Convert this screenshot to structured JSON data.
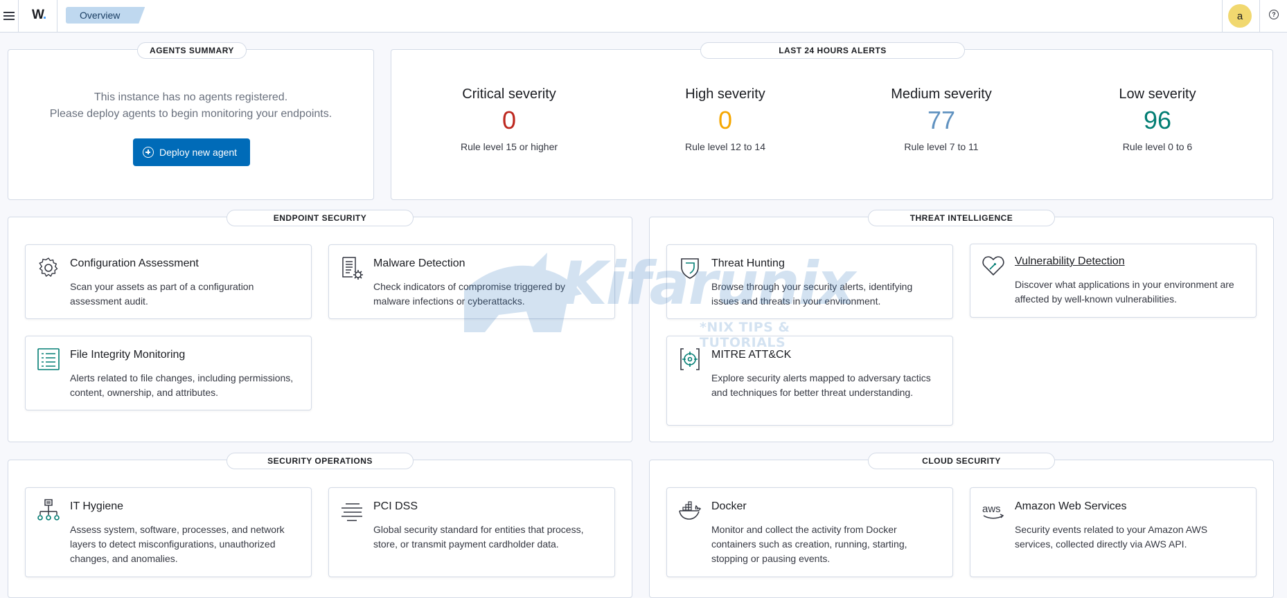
{
  "topbar": {
    "logo": "W",
    "logo_dot": ".",
    "breadcrumb": "Overview",
    "avatar_initial": "a",
    "help_glyph": "?"
  },
  "agents_summary": {
    "title": "AGENTS SUMMARY",
    "line1": "This instance has no agents registered.",
    "line2": "Please deploy agents to begin monitoring your endpoints.",
    "deploy_button": "Deploy new agent"
  },
  "alerts": {
    "title": "LAST 24 HOURS ALERTS",
    "items": [
      {
        "label": "Critical severity",
        "value": "0",
        "rule": "Rule level 15 or higher",
        "color": "#bd271e"
      },
      {
        "label": "High severity",
        "value": "0",
        "rule": "Rule level 12 to 14",
        "color": "#f5a700"
      },
      {
        "label": "Medium severity",
        "value": "77",
        "rule": "Rule level 7 to 11",
        "color": "#6092c0"
      },
      {
        "label": "Low severity",
        "value": "96",
        "rule": "Rule level 0 to 6",
        "color": "#017d73"
      }
    ]
  },
  "endpoint_security": {
    "title": "ENDPOINT SECURITY",
    "cards": [
      {
        "icon": "gear-icon",
        "title": "Configuration Assessment",
        "desc": "Scan your assets as part of a configuration assessment audit."
      },
      {
        "icon": "malware-report-icon",
        "title": "Malware Detection",
        "desc": "Check indicators of compromise triggered by malware infections or cyberattacks."
      },
      {
        "icon": "file-list-icon",
        "title": "File Integrity Monitoring",
        "desc": "Alerts related to file changes, including permissions, content, ownership, and attributes."
      }
    ]
  },
  "threat_intelligence": {
    "title": "THREAT INTELLIGENCE",
    "cards": [
      {
        "icon": "shield-icon",
        "title": "Threat Hunting",
        "desc": "Browse through your security alerts, identifying issues and threats in your environment."
      },
      {
        "icon": "heart-shield-icon",
        "title": "Vulnerability Detection",
        "desc": "Discover what applications in your environment are affected by well-known vulnerabilities."
      },
      {
        "icon": "target-icon",
        "title": "MITRE ATT&CK",
        "desc": "Explore security alerts mapped to adversary tactics and techniques for better threat understanding."
      }
    ]
  },
  "security_operations": {
    "title": "SECURITY OPERATIONS",
    "cards": [
      {
        "icon": "network-tree-icon",
        "title": "IT Hygiene",
        "desc": "Assess system, software, processes, and network layers to detect misconfigurations, unauthorized changes, and anomalies."
      },
      {
        "icon": "lines-icon",
        "title": "PCI DSS",
        "desc": "Global security standard for entities that process, store, or transmit payment cardholder data."
      }
    ]
  },
  "cloud_security": {
    "title": "CLOUD SECURITY",
    "cards": [
      {
        "icon": "docker-icon",
        "title": "Docker",
        "desc": "Monitor and collect the activity from Docker containers such as creation, running, starting, stopping or pausing events."
      },
      {
        "icon": "aws-icon",
        "title": "Amazon Web Services",
        "desc": "Security events related to your Amazon AWS services, collected directly via AWS API."
      }
    ]
  },
  "watermark": {
    "text": "Kifarunix",
    "subtitle": "*NIX TIPS & TUTORIALS"
  }
}
